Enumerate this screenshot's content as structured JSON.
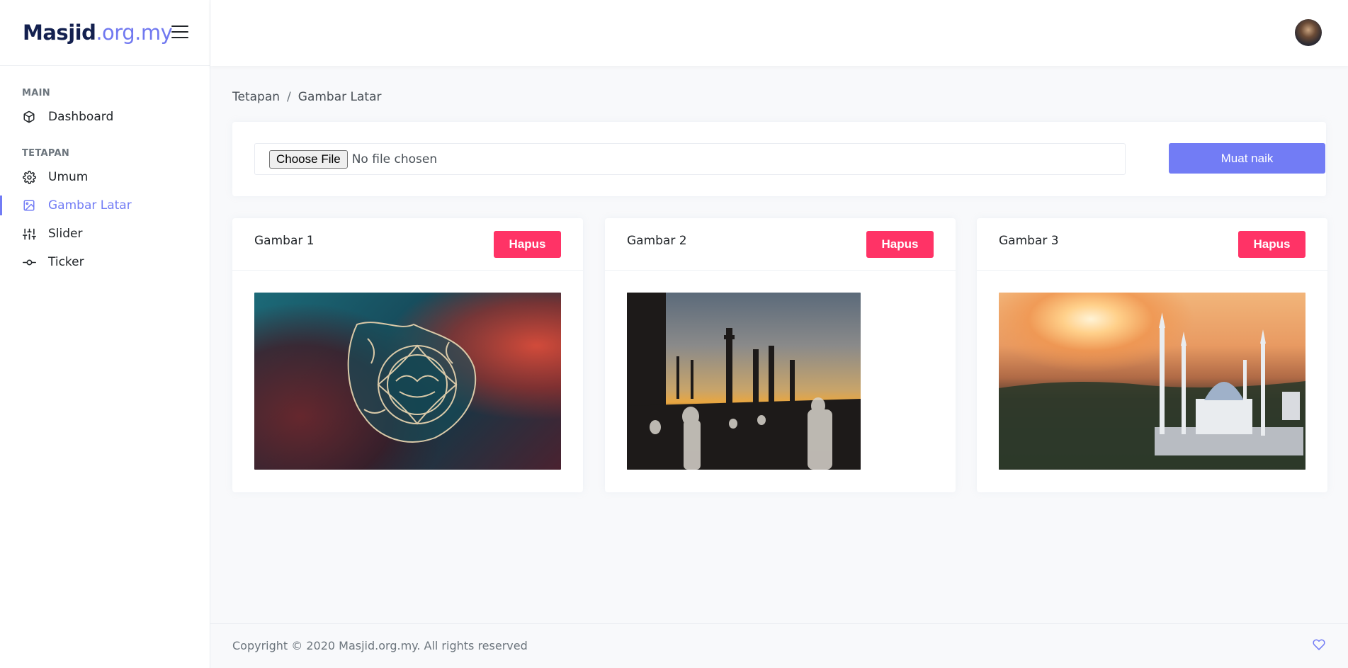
{
  "brand": {
    "bold": "Masjid",
    "light": ".org.my"
  },
  "sidebar": {
    "sections": [
      {
        "title": "MAIN",
        "items": [
          {
            "label": "Dashboard",
            "icon": "box-icon"
          }
        ]
      },
      {
        "title": "TETAPAN",
        "items": [
          {
            "label": "Umum",
            "icon": "settings-icon"
          },
          {
            "label": "Gambar Latar",
            "icon": "image-icon",
            "active": true
          },
          {
            "label": "Slider",
            "icon": "sliders-icon"
          },
          {
            "label": "Ticker",
            "icon": "git-commit-icon"
          }
        ]
      }
    ]
  },
  "breadcrumb": {
    "items": [
      "Tetapan",
      "Gambar Latar"
    ],
    "separator": "/"
  },
  "upload": {
    "choose_label": "Choose File",
    "status": "No file chosen",
    "button_label": "Muat naik"
  },
  "images": [
    {
      "title": "Gambar 1",
      "delete_label": "Hapus"
    },
    {
      "title": "Gambar 2",
      "delete_label": "Hapus"
    },
    {
      "title": "Gambar 3",
      "delete_label": "Hapus"
    }
  ],
  "footer": {
    "copyright": "Copyright © 2020 Masjid.org.my. All rights reserved"
  },
  "colors": {
    "primary": "#727cf5",
    "danger": "#ff3366",
    "brand_dark": "#13204f"
  }
}
